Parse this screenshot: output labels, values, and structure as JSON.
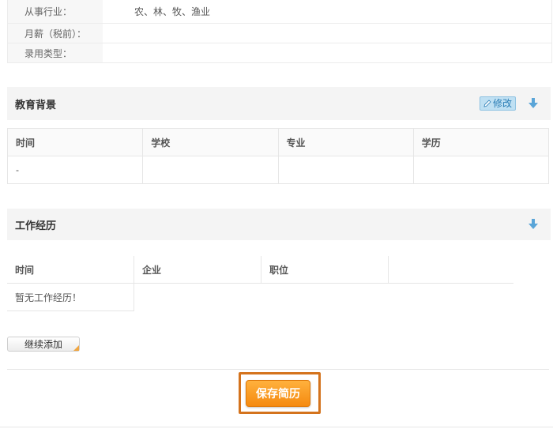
{
  "info_rows": [
    {
      "label": "从事行业：",
      "value": "农、林、牧、渔业"
    },
    {
      "label": "月薪（税前）：",
      "value": ""
    },
    {
      "label": "录用类型：",
      "value": ""
    }
  ],
  "education": {
    "title": "教育背景",
    "edit_label": "修改",
    "columns": [
      "时间",
      "学校",
      "专业",
      "学历"
    ],
    "rows": [
      [
        "-",
        "",
        "",
        ""
      ]
    ]
  },
  "work": {
    "title": "工作经历",
    "columns": [
      "时间",
      "企业",
      "职位",
      ""
    ],
    "empty_text": "暂无工作经历！"
  },
  "buttons": {
    "add_label": "继续添加",
    "save_label": "保存简历"
  },
  "colors": {
    "accent": "#f58a10",
    "highlight_frame": "#d4731d",
    "edit_bg": "#bfe0f3"
  }
}
